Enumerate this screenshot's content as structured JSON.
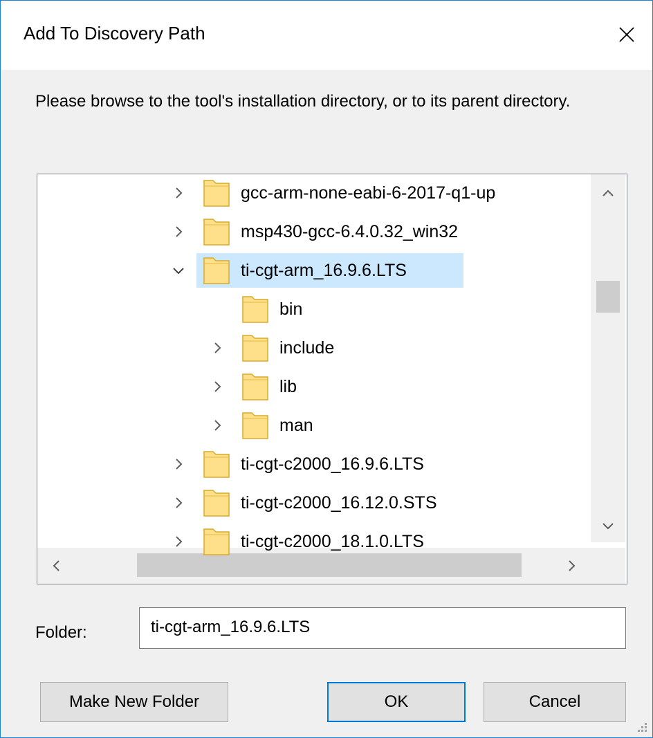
{
  "dialog": {
    "title": "Add To Discovery Path",
    "instructions": "Please browse to the tool's installation directory, or to its parent directory."
  },
  "tree": {
    "items": [
      {
        "label": "gcc-arm-none-eabi-6-2017-q1-up",
        "level": 0,
        "expander": "collapsed",
        "selected": false
      },
      {
        "label": "msp430-gcc-6.4.0.32_win32",
        "level": 0,
        "expander": "collapsed",
        "selected": false
      },
      {
        "label": "ti-cgt-arm_16.9.6.LTS",
        "level": 0,
        "expander": "expanded",
        "selected": true
      },
      {
        "label": "bin",
        "level": 1,
        "expander": "none",
        "selected": false
      },
      {
        "label": "include",
        "level": 1,
        "expander": "collapsed",
        "selected": false
      },
      {
        "label": "lib",
        "level": 1,
        "expander": "collapsed",
        "selected": false
      },
      {
        "label": "man",
        "level": 1,
        "expander": "collapsed",
        "selected": false
      },
      {
        "label": "ti-cgt-c2000_16.9.6.LTS",
        "level": 0,
        "expander": "collapsed",
        "selected": false
      },
      {
        "label": "ti-cgt-c2000_16.12.0.STS",
        "level": 0,
        "expander": "collapsed",
        "selected": false
      },
      {
        "label": "ti-cgt-c2000_18.1.0.LTS",
        "level": 0,
        "expander": "collapsed",
        "selected": false
      }
    ]
  },
  "folder": {
    "label": "Folder:",
    "value": "ti-cgt-arm_16.9.6.LTS"
  },
  "buttons": {
    "make_new_folder": "Make New Folder",
    "ok": "OK",
    "cancel": "Cancel"
  },
  "colors": {
    "selection": "#cce8ff",
    "folder_fill": "#ffe08a",
    "accent_border": "#0078d7"
  }
}
